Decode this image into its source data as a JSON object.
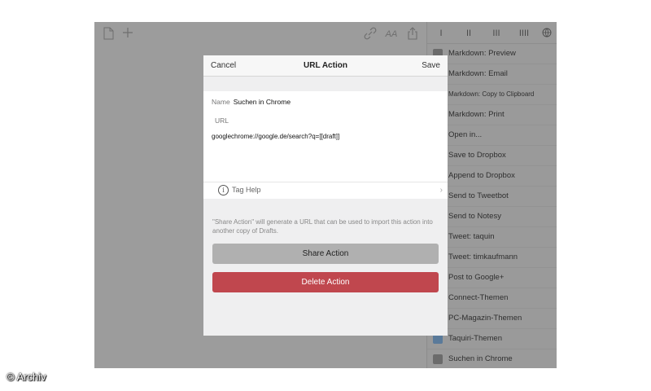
{
  "modal": {
    "cancel_label": "Cancel",
    "title": "URL Action",
    "save_label": "Save",
    "name_label": "Name",
    "name_value": "Suchen in Chrome",
    "url_label": "URL",
    "url_value": "googlechrome://google.de/search?q=[[draft]]",
    "tag_help_label": "Tag Help",
    "share_note": "\"Share Action\" will generate a URL that can be used to import this action into another copy of Drafts.",
    "share_action_label": "Share Action",
    "delete_action_label": "Delete Action"
  },
  "editor_toolbar": {
    "icons": [
      "new-document-icon",
      "add-icon",
      "link-icon",
      "font-size-icon",
      "share-icon"
    ]
  },
  "sidebar": {
    "tabs": [
      "I",
      "II",
      "III",
      "IIII"
    ],
    "items": [
      {
        "label": "Markdown: Preview",
        "icon": "markdown-icon"
      },
      {
        "label": "Markdown: Email",
        "icon": "email-icon"
      },
      {
        "label": "Markdown: Copy to Clipboard",
        "icon": "clipboard-icon"
      },
      {
        "label": "Markdown: Print",
        "icon": "print-icon"
      },
      {
        "label": "Open in...",
        "icon": "open-in-icon"
      },
      {
        "label": "Save to Dropbox",
        "icon": "dropbox-icon"
      },
      {
        "label": "Append to Dropbox",
        "icon": "dropbox-icon"
      },
      {
        "label": "Send to Tweetbot",
        "icon": "tweetbot-icon"
      },
      {
        "label": "Send to Notesy",
        "icon": "notesy-icon"
      },
      {
        "label": "Tweet: taquin",
        "icon": "twitter-icon"
      },
      {
        "label": "Tweet: timkaufmann",
        "icon": "twitter-icon"
      },
      {
        "label": "Post to Google+",
        "icon": "google-plus-icon"
      },
      {
        "label": "Connect-Themen",
        "icon": "action-icon"
      },
      {
        "label": "PC-Magazin-Themen",
        "icon": "action-icon"
      },
      {
        "label": "Taquiri-Themen",
        "icon": "action-icon"
      },
      {
        "label": "Suchen in Chrome",
        "icon": "chrome-icon"
      }
    ]
  },
  "watermark": "© Archiv",
  "colors": {
    "delete": "#c0474e",
    "share": "#b0b0b0",
    "dim_background": "#9b9b9b"
  }
}
